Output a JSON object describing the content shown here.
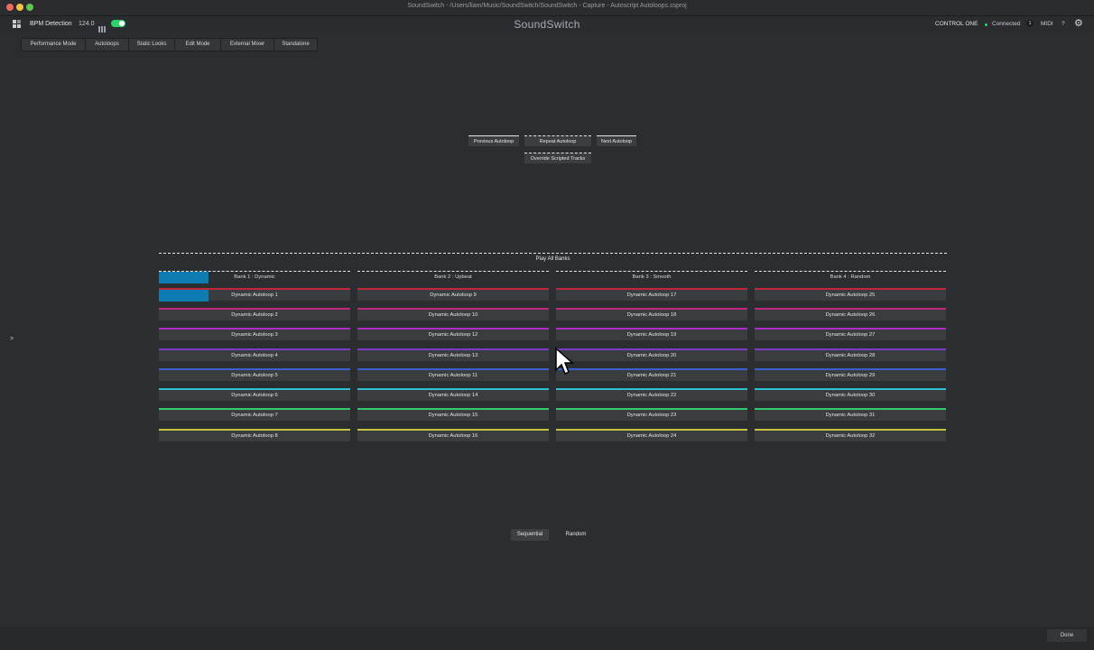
{
  "window_title": "SoundSwitch - /Users/liam/Music/SoundSwitch/SoundSwitch - Capture - Autoscript Autoloops.ssproj",
  "header": {
    "bpm_label": "BPM Detection",
    "bpm_value": "124.0",
    "brand": "SoundSwitch",
    "device": "CONTROL ONE",
    "status": "Connected",
    "status_count": "1",
    "midi": "MIDI",
    "help": "?",
    "icons": [
      "grid-icon",
      "gear-icon"
    ],
    "toggle_on": true,
    "accent": "#2fcf6c"
  },
  "tabs": [
    "Performance Mode",
    "Autoloops",
    "Static Looks",
    "Edit Mode",
    "External Mixer",
    "Standalone"
  ],
  "controls": {
    "previous": "Previous Autoloop",
    "repeat": "Repeat Autoloop",
    "next": "Next Autoloop",
    "override": "Override Scripted Tracks"
  },
  "play_all": "Play All Banks",
  "banks": [
    {
      "label": "Bank 1 : Dynamic",
      "loops": [
        "Dynamic Autoloop 1",
        "Dynamic Autoloop 2",
        "Dynamic Autoloop 3",
        "Dynamic Autoloop 4",
        "Dynamic Autoloop 5",
        "Dynamic Autoloop 6",
        "Dynamic Autoloop 7",
        "Dynamic Autoloop 8"
      ]
    },
    {
      "label": "Bank 2 : Upbeat",
      "loops": [
        "Dynamic Autoloop 9",
        "Dynamic Autoloop 10",
        "Dynamic Autoloop 12",
        "Dynamic Autoloop 13",
        "Dynamic Autoloop 11",
        "Dynamic Autoloop 14",
        "Dynamic Autoloop 15",
        "Dynamic Autoloop 16"
      ]
    },
    {
      "label": "Bank 3 : Smooth",
      "loops": [
        "Dynamic Autoloop 17",
        "Dynamic Autoloop 18",
        "Dynamic Autoloop 19",
        "Dynamic Autoloop 20",
        "Dynamic Autoloop 21",
        "Dynamic Autoloop 22",
        "Dynamic Autoloop 23",
        "Dynamic Autoloop 24"
      ]
    },
    {
      "label": "Bank 4 : Random",
      "loops": [
        "Dynamic Autoloop 25",
        "Dynamic Autoloop 26",
        "Dynamic Autoloop 27",
        "Dynamic Autoloop 28",
        "Dynamic Autoloop 29",
        "Dynamic Autoloop 30",
        "Dynamic Autoloop 31",
        "Dynamic Autoloop 32"
      ]
    }
  ],
  "row_colors": [
    "#c0283a",
    "#c2257e",
    "#b02cc4",
    "#7b3cc8",
    "#3a5fcf",
    "#2fc0d0",
    "#33c86a",
    "#c8c23a"
  ],
  "active_fill_color": "#0f7bb3",
  "bank1_progress": 0.26,
  "loop1_progress": 0.26,
  "modes": {
    "sequential": "Sequential",
    "random": "Random",
    "selected": "Sequential"
  },
  "footer": {
    "done": "Done"
  },
  "side_arrow": ">"
}
